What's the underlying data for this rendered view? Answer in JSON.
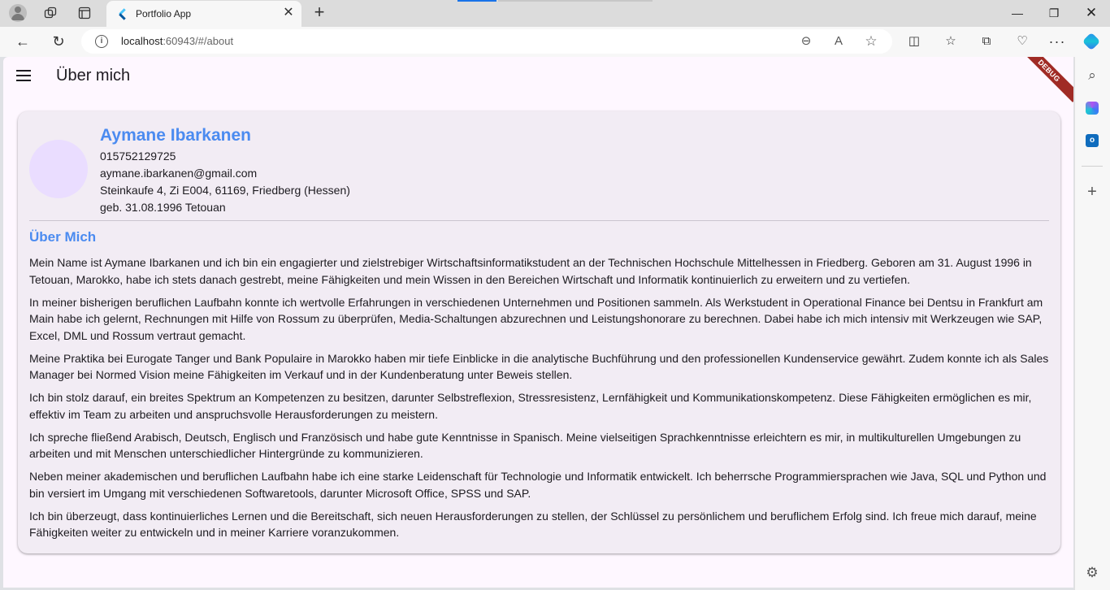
{
  "browser": {
    "tab_title": "Portfolio App",
    "url_host": "localhost",
    "url_rest": ":60943/#/about",
    "icons": {
      "close_tab": "✕",
      "new_tab": "+",
      "minimize": "—",
      "maximize": "❐",
      "close_window": "✕",
      "back": "←",
      "reload": "↻",
      "zoom": "⊖",
      "read_aloud": "A",
      "favorite": "☆",
      "split": "◫",
      "favorites": "☆",
      "collections": "⧉",
      "performance": "♡",
      "more": "···",
      "search": "⌕",
      "add": "+",
      "settings": "⚙",
      "outlook_letter": "o"
    }
  },
  "app": {
    "title": "Über mich",
    "debug_label": "DEBUG"
  },
  "profile": {
    "name": "Aymane Ibarkanen",
    "phone": "015752129725",
    "email": "aymane.ibarkanen@gmail.com",
    "address": "Steinkaufe 4, Zi E004, 61169, Friedberg (Hessen)",
    "birth": "geb. 31.08.1996 Tetouan"
  },
  "about": {
    "heading": "Über Mich",
    "paragraphs": [
      "Mein Name ist Aymane Ibarkanen und ich bin ein engagierter und zielstrebiger Wirtschaftsinformatikstudent an der Technischen Hochschule Mittelhessen in Friedberg. Geboren am 31. August 1996 in Tetouan, Marokko, habe ich stets danach gestrebt, meine Fähigkeiten und mein Wissen in den Bereichen Wirtschaft und Informatik kontinuierlich zu erweitern und zu vertiefen.",
      "In meiner bisherigen beruflichen Laufbahn konnte ich wertvolle Erfahrungen in verschiedenen Unternehmen und Positionen sammeln. Als Werkstudent in Operational Finance bei Dentsu in Frankfurt am Main habe ich gelernt, Rechnungen mit Hilfe von Rossum zu überprüfen, Media-Schaltungen abzurechnen und Leistungshonorare zu berechnen. Dabei habe ich mich intensiv mit Werkzeugen wie SAP, Excel, DML und Rossum vertraut gemacht.",
      "Meine Praktika bei Eurogate Tanger und Bank Populaire in Marokko haben mir tiefe Einblicke in die analytische Buchführung und den professionellen Kundenservice gewährt. Zudem konnte ich als Sales Manager bei Normed Vision meine Fähigkeiten im Verkauf und in der Kundenberatung unter Beweis stellen.",
      "Ich bin stolz darauf, ein breites Spektrum an Kompetenzen zu besitzen, darunter Selbstreflexion, Stressresistenz, Lernfähigkeit und Kommunikationskompetenz. Diese Fähigkeiten ermöglichen es mir, effektiv im Team zu arbeiten und anspruchsvolle Herausforderungen zu meistern.",
      "Ich spreche fließend Arabisch, Deutsch, Englisch und Französisch und habe gute Kenntnisse in Spanisch. Meine vielseitigen Sprachkenntnisse erleichtern es mir, in multikulturellen Umgebungen zu arbeiten und mit Menschen unterschiedlicher Hintergründe zu kommunizieren.",
      "Neben meiner akademischen und beruflichen Laufbahn habe ich eine starke Leidenschaft für Technologie und Informatik entwickelt. Ich beherrsche Programmiersprachen wie Java, SQL und Python und bin versiert im Umgang mit verschiedenen Softwaretools, darunter Microsoft Office, SPSS und SAP.",
      "Ich bin überzeugt, dass kontinuierliches Lernen und die Bereitschaft, sich neuen Herausforderungen zu stellen, der Schlüssel zu persönlichem und beruflichem Erfolg sind. Ich freue mich darauf, meine Fähigkeiten weiter zu entwickeln und in meiner Karriere voranzukommen."
    ]
  },
  "colors": {
    "accent": "#4b8bf0",
    "card_bg": "#f2ecf4",
    "page_bg": "#fef7ff",
    "avatar_bg": "#eaddff",
    "debug_banner": "#a02b25"
  }
}
